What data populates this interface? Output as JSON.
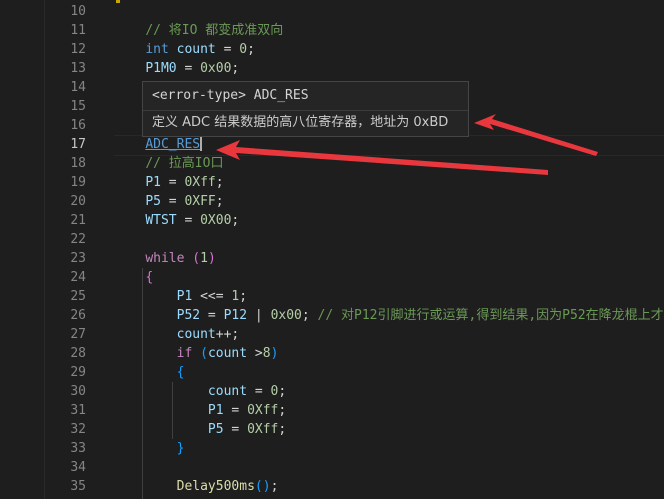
{
  "lines": [
    {
      "n": "10",
      "html": ""
    },
    {
      "n": "11",
      "html": "    <span class=\"cmt\">// 将IO 都变成准双向</span>"
    },
    {
      "n": "12",
      "html": "    <span class=\"kw\">int</span> <span class=\"var\">count</span> = <span class=\"num\">0</span>;"
    },
    {
      "n": "13",
      "html": "    <span class=\"var\">P1M0</span> = <span class=\"num\">0x00</span>;"
    },
    {
      "n": "14",
      "html": ""
    },
    {
      "n": "15",
      "html": ""
    },
    {
      "n": "16",
      "html": ""
    },
    {
      "n": "17",
      "html": "    <span class=\"macro\">ADC_RES</span><span class=\"cursor\"></span>"
    },
    {
      "n": "18",
      "html": "    <span class=\"cmt\">// 拉高IO口</span>"
    },
    {
      "n": "19",
      "html": "    <span class=\"var\">P1</span> = <span class=\"num\">0Xff</span>;"
    },
    {
      "n": "20",
      "html": "    <span class=\"var\">P5</span> = <span class=\"num\">0XFF</span>;"
    },
    {
      "n": "21",
      "html": "    <span class=\"var\">WTST</span> = <span class=\"num\">0X00</span>;"
    },
    {
      "n": "22",
      "html": ""
    },
    {
      "n": "23",
      "html": "    <span class=\"ctrl\">while</span> <span class=\"br2\">(</span><span class=\"num\">1</span><span class=\"br2\">)</span>"
    },
    {
      "n": "24",
      "html": "    <span class=\"br2\">{</span>"
    },
    {
      "n": "25",
      "html": "        <span class=\"var\">P1</span> &lt;&lt;= <span class=\"num\">1</span>;"
    },
    {
      "n": "26",
      "html": "        <span class=\"var\">P52</span> = <span class=\"var\">P12</span> | <span class=\"num\">0x00</span>; <span class=\"cmt\">// 对P12引脚进行或运算,得到结果,因为P52在降龙棍上才</span>"
    },
    {
      "n": "27",
      "html": "        <span class=\"var\">count</span>++;"
    },
    {
      "n": "28",
      "html": "        <span class=\"ctrl\">if</span> <span class=\"br3\">(</span><span class=\"var\">count</span> &gt;<span class=\"num\">8</span><span class=\"br3\">)</span>"
    },
    {
      "n": "29",
      "html": "        <span class=\"br3\">{</span>"
    },
    {
      "n": "30",
      "html": "            <span class=\"var\">count</span> = <span class=\"num\">0</span>;"
    },
    {
      "n": "31",
      "html": "            <span class=\"var\">P1</span> = <span class=\"num\">0Xff</span>;"
    },
    {
      "n": "32",
      "html": "            <span class=\"var\">P5</span> = <span class=\"num\">0Xff</span>;"
    },
    {
      "n": "33",
      "html": "        <span class=\"br3\">}</span>"
    },
    {
      "n": "34",
      "html": ""
    },
    {
      "n": "35",
      "html": "        <span class=\"fn\">Delay500ms</span><span class=\"br3\">()</span>;"
    }
  ],
  "hover": {
    "signature": "<error-type> ADC_RES",
    "documentation": "定义 ADC 结果数据的高八位寄存器，地址为 0xBD"
  }
}
